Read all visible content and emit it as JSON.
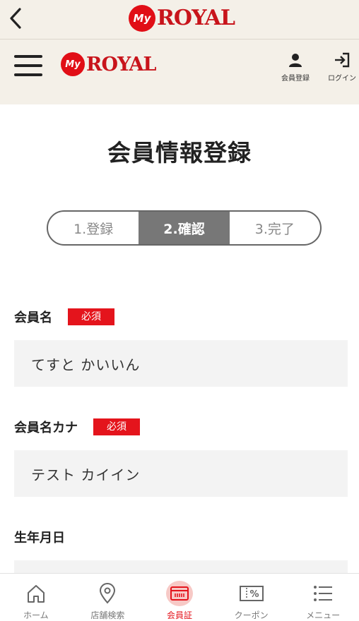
{
  "appbar": {
    "brand_my": "My",
    "brand_royal": "ROYAL"
  },
  "header": {
    "brand_my": "My",
    "brand_royal": "ROYAL",
    "member_register_label": "会員登録",
    "login_label": "ログイン"
  },
  "page": {
    "title": "会員情報登録"
  },
  "steps": [
    {
      "label": "1.登録",
      "active": false
    },
    {
      "label": "2.確認",
      "active": true
    },
    {
      "label": "3.完了",
      "active": false
    }
  ],
  "form": {
    "required_badge": "必須",
    "fields": [
      {
        "label": "会員名",
        "required": true,
        "value": "てすと かいいん"
      },
      {
        "label": "会員名カナ",
        "required": true,
        "value": "テスト カイイン"
      },
      {
        "label": "生年月日",
        "required": false,
        "value": ""
      }
    ]
  },
  "bottom_nav": [
    {
      "label": "ホーム",
      "icon": "home-icon",
      "active": false
    },
    {
      "label": "店舗検索",
      "icon": "map-pin-icon",
      "active": false
    },
    {
      "label": "会員証",
      "icon": "member-card-icon",
      "active": true
    },
    {
      "label": "クーポン",
      "icon": "coupon-icon",
      "active": false
    },
    {
      "label": "メニュー",
      "icon": "menu-list-icon",
      "active": false
    }
  ],
  "colors": {
    "brand_red": "#e10e16",
    "header_bg": "#f4f0e8",
    "active_step": "#777777"
  }
}
